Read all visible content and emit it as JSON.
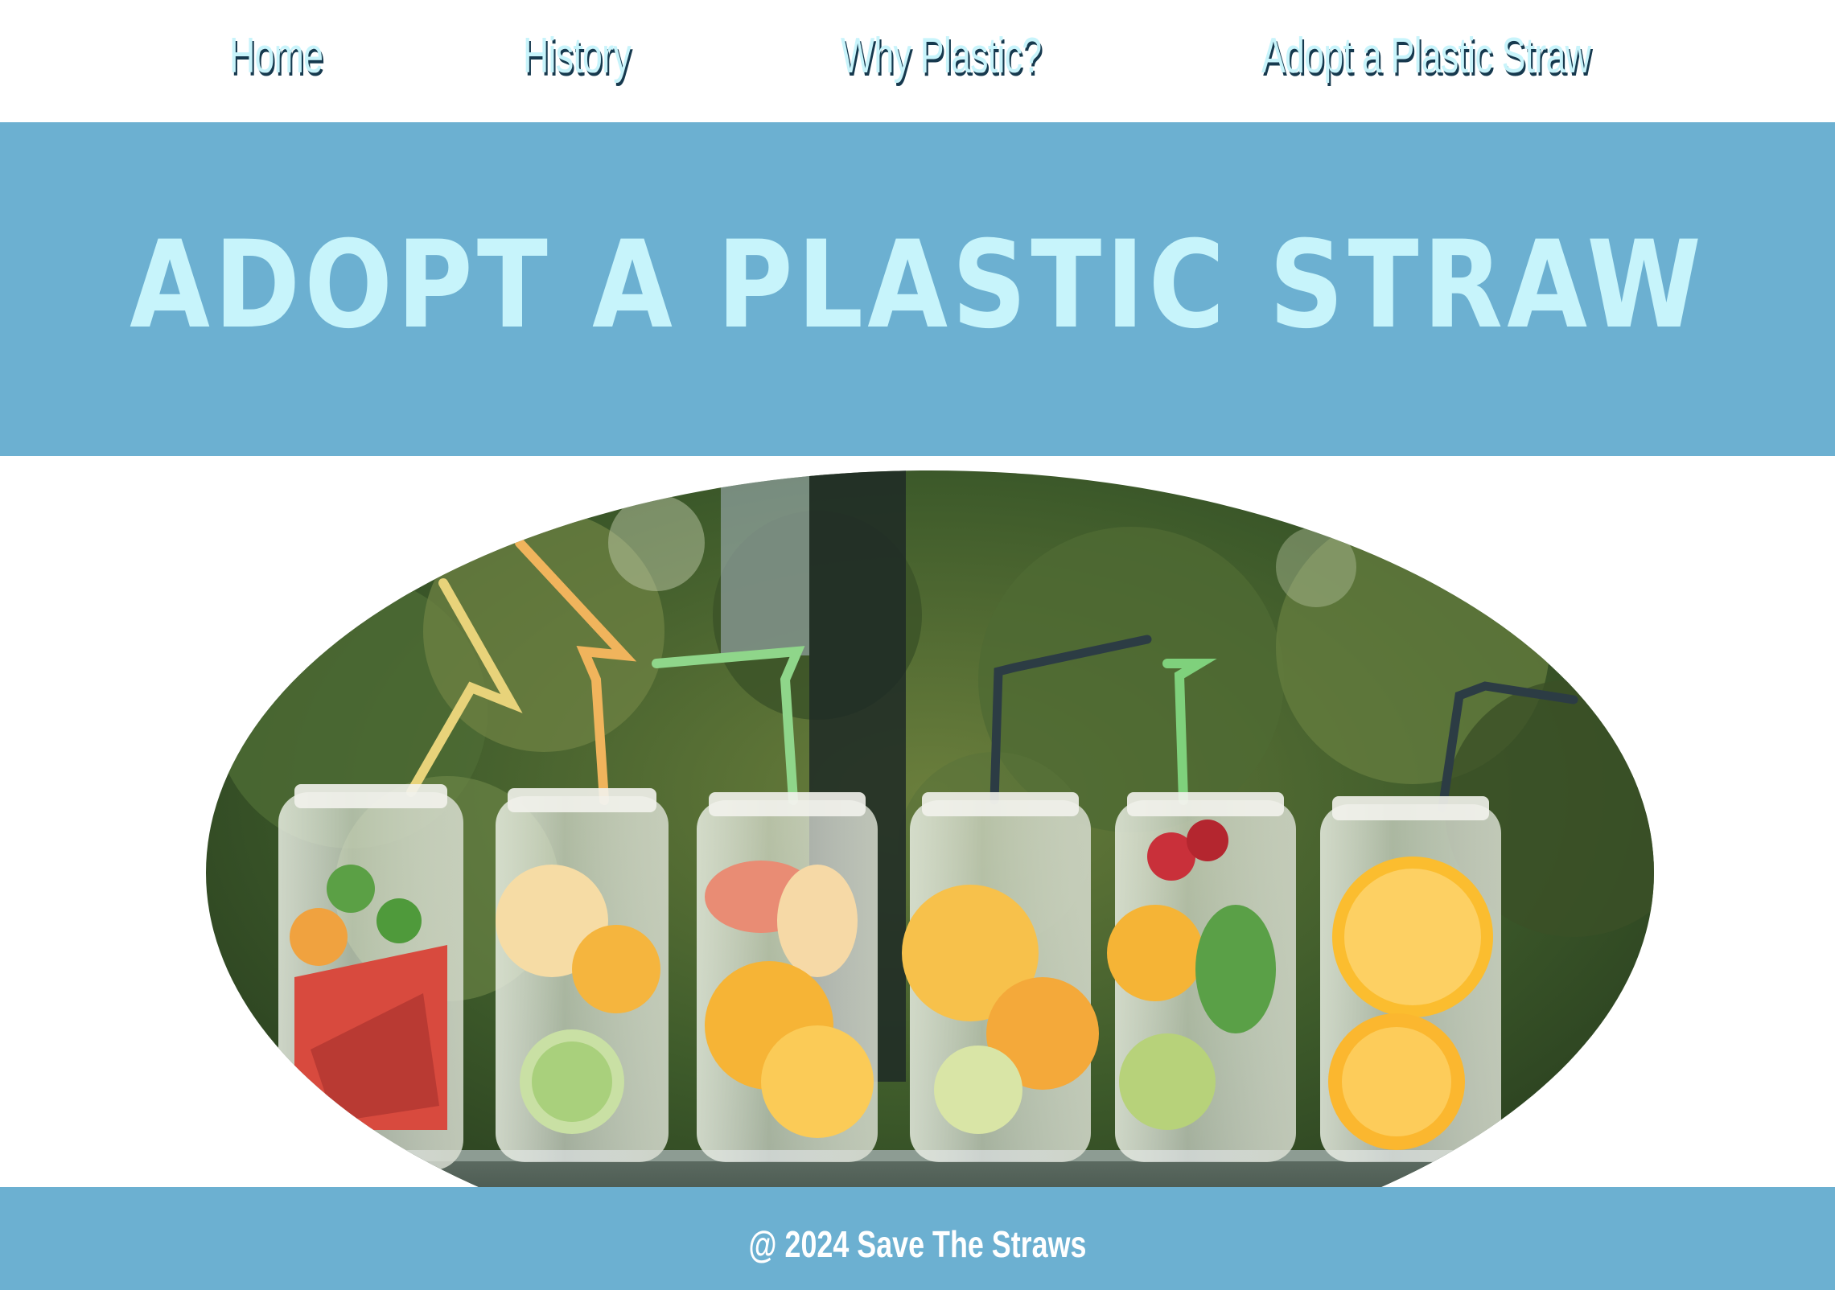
{
  "nav": {
    "items": [
      {
        "label": "Home"
      },
      {
        "label": "History"
      },
      {
        "label": "Why Plastic?"
      },
      {
        "label": "Adopt a Plastic Straw"
      }
    ]
  },
  "hero": {
    "title": "ADOPT A PLASTIC STRAW"
  },
  "footer": {
    "text": "@ 2024 Save The Straws"
  },
  "colors": {
    "accent": "#6cb0d1",
    "title_text": "#c7f4fb",
    "nav_text": "#c8f4fb",
    "nav_shadow": "#16394e"
  }
}
